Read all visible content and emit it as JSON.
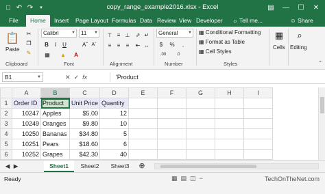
{
  "window": {
    "title": "copy_range_example2016.xlsx - Excel"
  },
  "tabs": {
    "file": "File",
    "home": "Home",
    "insert": "Insert",
    "page_layout": "Page Layout",
    "formulas": "Formulas",
    "data": "Data",
    "review": "Review",
    "view": "View",
    "developer": "Developer",
    "tell_me": "Tell me...",
    "share": "Share"
  },
  "ribbon": {
    "clipboard": {
      "paste": "Paste",
      "label": "Clipboard"
    },
    "font": {
      "name": "Calibri",
      "size": "11",
      "label": "Font"
    },
    "alignment": {
      "label": "Alignment"
    },
    "number": {
      "format": "General",
      "label": "Number"
    },
    "styles": {
      "conditional": "Conditional Formatting",
      "format_table": "Format as Table",
      "cell_styles": "Cell Styles",
      "label": "Styles"
    },
    "cells": "Cells",
    "editing": "Editing"
  },
  "formula_bar": {
    "name_box": "B1",
    "fx": "fx",
    "content": "'Product"
  },
  "sheet": {
    "columns": [
      "A",
      "B",
      "C",
      "D",
      "E",
      "F",
      "G",
      "H",
      "I"
    ],
    "rows": [
      [
        "1",
        "Order ID",
        "Product",
        "Unit Price",
        "Quantity",
        "",
        "",
        "",
        "",
        ""
      ],
      [
        "2",
        "10247",
        "Apples",
        "$5.00",
        "12",
        "",
        "",
        "",
        "",
        ""
      ],
      [
        "3",
        "10249",
        "Oranges",
        "$9.80",
        "10",
        "",
        "",
        "",
        "",
        ""
      ],
      [
        "4",
        "10250",
        "Bananas",
        "$34.80",
        "5",
        "",
        "",
        "",
        "",
        ""
      ],
      [
        "5",
        "10251",
        "Pears",
        "$18.60",
        "6",
        "",
        "",
        "",
        "",
        ""
      ],
      [
        "6",
        "10252",
        "Grapes",
        "$42.30",
        "40",
        "",
        "",
        "",
        "",
        ""
      ],
      [
        "7",
        "",
        "",
        "",
        "",
        "",
        "",
        "",
        "",
        ""
      ]
    ]
  },
  "sheet_tabs": [
    "Sheet1",
    "Sheet2",
    "Sheet3"
  ],
  "status": {
    "ready": "Ready",
    "brand": "TechOnTheNet.com"
  },
  "colors": {
    "accent": "#217346",
    "header_fill": "#e8e8f8"
  }
}
